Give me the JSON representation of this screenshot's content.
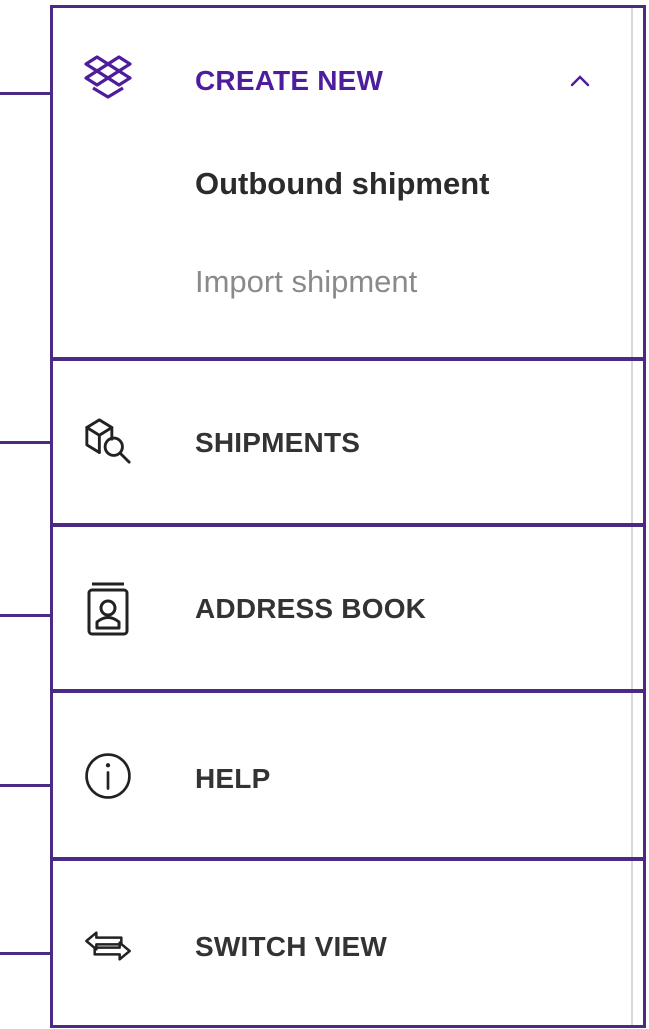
{
  "menu": {
    "create_new": {
      "label": "CREATE NEW",
      "icon": "dropbox-boxes-icon",
      "expanded": true,
      "items": [
        {
          "label": "Outbound shipment",
          "active": true
        },
        {
          "label": "Import shipment",
          "active": false
        }
      ]
    },
    "shipments": {
      "label": "SHIPMENTS",
      "icon": "box-search-icon"
    },
    "address_book": {
      "label": "ADDRESS BOOK",
      "icon": "address-book-icon"
    },
    "help": {
      "label": "HELP",
      "icon": "info-circle-icon"
    },
    "switch_view": {
      "label": "SWITCH VIEW",
      "icon": "swap-arrows-icon"
    }
  },
  "colors": {
    "accent": "#4d1d9c",
    "border": "#4b2a86",
    "text": "#333333",
    "muted": "#8a8a8a"
  }
}
